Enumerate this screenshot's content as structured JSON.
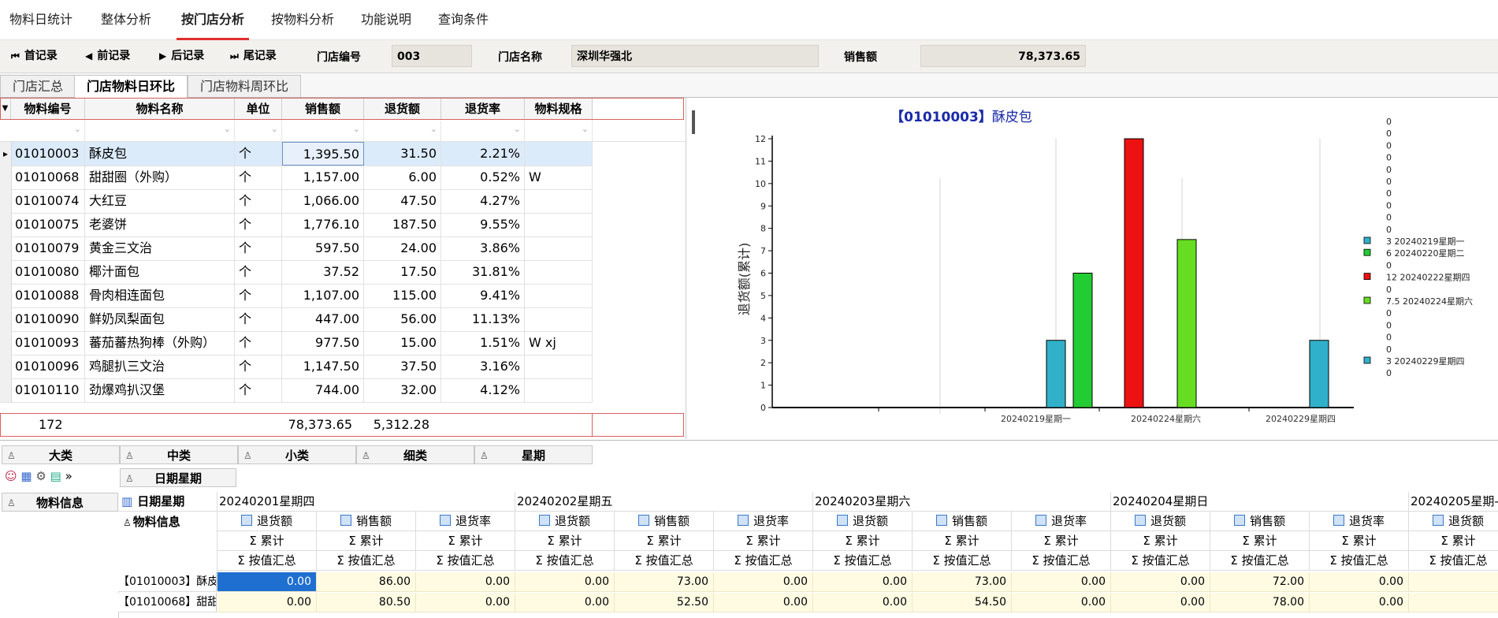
{
  "menu": {
    "items": [
      {
        "label": "物料日统计",
        "active": false
      },
      {
        "label": "整体分析",
        "active": false
      },
      {
        "label": "按门店分析",
        "active": true
      },
      {
        "label": "按物料分析",
        "active": false
      },
      {
        "label": "功能说明",
        "active": false
      },
      {
        "label": "查询条件",
        "active": false
      }
    ]
  },
  "record_bar": {
    "first": "首记录",
    "prev": "前记录",
    "next": "后记录",
    "last": "尾记录",
    "store_no_label": "门店编号",
    "store_no_value": "003",
    "store_name_label": "门店名称",
    "store_name_value": "深圳华强北",
    "sales_label": "销售额",
    "sales_value": "78,373.65"
  },
  "sub_tabs": [
    {
      "label": "门店汇总",
      "active": false
    },
    {
      "label": "门店物料日环比",
      "active": true
    },
    {
      "label": "门店物料周环比",
      "active": false
    }
  ],
  "grid": {
    "columns": [
      "物料编号",
      "物料名称",
      "单位",
      "销售额",
      "退货额",
      "退货率",
      "物料规格"
    ],
    "rows": [
      [
        "01010003",
        "酥皮包",
        "个",
        "1,395.50",
        "31.50",
        "2.21%",
        ""
      ],
      [
        "01010068",
        "甜甜圈（外购）",
        "个",
        "1,157.00",
        "6.00",
        "0.52%",
        "W"
      ],
      [
        "01010074",
        "大红豆",
        "个",
        "1,066.00",
        "47.50",
        "4.27%",
        ""
      ],
      [
        "01010075",
        "老婆饼",
        "个",
        "1,776.10",
        "187.50",
        "9.55%",
        ""
      ],
      [
        "01010079",
        "黄金三文治",
        "个",
        "597.50",
        "24.00",
        "3.86%",
        ""
      ],
      [
        "01010080",
        "椰汁面包",
        "个",
        "37.52",
        "17.50",
        "31.81%",
        ""
      ],
      [
        "01010088",
        "骨肉相连面包",
        "个",
        "1,107.00",
        "115.00",
        "9.41%",
        ""
      ],
      [
        "01010090",
        "鲜奶凤梨面包",
        "个",
        "447.00",
        "56.00",
        "11.13%",
        ""
      ],
      [
        "01010093",
        "蕃茄蕃热狗棒（外购）",
        "个",
        "977.50",
        "15.00",
        "1.51%",
        "W  xj"
      ],
      [
        "01010096",
        "鸡腿扒三文治",
        "个",
        "1,147.50",
        "37.50",
        "3.16%",
        ""
      ],
      [
        "01010110",
        "劲爆鸡扒汉堡",
        "个",
        "744.00",
        "32.00",
        "4.12%",
        ""
      ]
    ],
    "footer": {
      "count": "172",
      "sales_total": "78,373.65",
      "return_total": "5,312.28"
    }
  },
  "chart_data": {
    "type": "bar",
    "title_code": "【01010003】",
    "title_name": "酥皮包",
    "ylabel": "退货额(累计)",
    "ylim": [
      0,
      12
    ],
    "yticks": [
      0,
      1,
      2,
      3,
      4,
      5,
      6,
      7,
      8,
      9,
      10,
      11,
      12
    ],
    "x_tick_labels": [
      "20240219星期一",
      "20240224星期六",
      "20240229星期四"
    ],
    "bars": [
      {
        "label": "20240219星期一",
        "value": 3,
        "color": "#31b0c9"
      },
      {
        "label": "20240220星期二",
        "value": 6,
        "color": "#22cc33"
      },
      {
        "label": "20240222星期四",
        "value": 12,
        "color": "#ee1111"
      },
      {
        "label": "20240224星期六",
        "value": 7.5,
        "color": "#66dd22"
      },
      {
        "label": "20240229星期四",
        "value": 3,
        "color": "#31b0c9"
      }
    ],
    "legend": [
      {
        "text": "0",
        "swatch": ""
      },
      {
        "text": "0",
        "swatch": ""
      },
      {
        "text": "0",
        "swatch": ""
      },
      {
        "text": "0",
        "swatch": ""
      },
      {
        "text": "0",
        "swatch": ""
      },
      {
        "text": "0",
        "swatch": ""
      },
      {
        "text": "0",
        "swatch": ""
      },
      {
        "text": "0",
        "swatch": ""
      },
      {
        "text": "0",
        "swatch": ""
      },
      {
        "text": "0",
        "swatch": ""
      },
      {
        "text": "3  20240219星期一",
        "swatch": "#31b0c9"
      },
      {
        "text": "6  20240220星期二",
        "swatch": "#22cc33"
      },
      {
        "text": "0",
        "swatch": ""
      },
      {
        "text": "12  20240222星期四",
        "swatch": "#ee1111"
      },
      {
        "text": "0",
        "swatch": ""
      },
      {
        "text": "7.5  20240224星期六",
        "swatch": "#66dd22"
      },
      {
        "text": "0",
        "swatch": ""
      },
      {
        "text": "0",
        "swatch": ""
      },
      {
        "text": "0",
        "swatch": ""
      },
      {
        "text": "0",
        "swatch": ""
      },
      {
        "text": "3  20240229星期四",
        "swatch": "#31b0c9"
      },
      {
        "text": "0",
        "swatch": ""
      }
    ]
  },
  "pivot": {
    "filter_fields": [
      "大类",
      "中类",
      "小类",
      "细类",
      "星期"
    ],
    "column_field": "日期星期",
    "row_field": "物料信息",
    "corner_col_label": "日期星期",
    "corner_row_label": "物料信息",
    "dates": [
      "20240201星期四",
      "20240202星期五",
      "20240203星期六",
      "20240204星期日",
      "20240205星期-"
    ],
    "measures": [
      "退货额",
      "销售额",
      "退货率"
    ],
    "cum_label": "Σ 累计",
    "agg_label": "Σ 按值汇总",
    "rows": [
      {
        "label": "【01010003】酥皮",
        "values": [
          "0.00",
          "86.00",
          "0.00",
          "0.00",
          "73.00",
          "0.00",
          "0.00",
          "73.00",
          "0.00",
          "0.00",
          "72.00",
          "0.00",
          "("
        ]
      },
      {
        "label": "【01010068】甜甜",
        "values": [
          "0.00",
          "80.50",
          "0.00",
          "0.00",
          "52.50",
          "0.00",
          "0.00",
          "54.50",
          "0.00",
          "0.00",
          "78.00",
          "0.00",
          "("
        ]
      }
    ]
  }
}
